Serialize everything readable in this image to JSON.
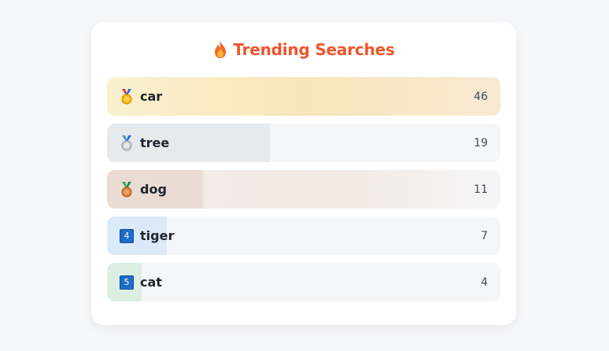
{
  "colors": {
    "accent": "#f0552c",
    "gold": "#f9e7bb",
    "silver": "#e6e9ec",
    "bronze": "#ecdcd2",
    "blue": "#dbeaf8",
    "green": "#dcefe2"
  },
  "title": {
    "icon": "fire-icon",
    "text": "Trending Searches"
  },
  "items": [
    {
      "icon": "gold-medal-icon",
      "label": "car",
      "count": "46",
      "value": 46
    },
    {
      "icon": "silver-medal-icon",
      "label": "tree",
      "count": "19",
      "value": 19
    },
    {
      "icon": "bronze-medal-icon",
      "label": "dog",
      "count": "11",
      "value": 11
    },
    {
      "icon": "keycap-4-icon",
      "rank": "4",
      "label": "tiger",
      "count": "7",
      "value": 7
    },
    {
      "icon": "keycap-5-icon",
      "rank": "5",
      "label": "cat",
      "count": "4",
      "value": 4
    }
  ]
}
